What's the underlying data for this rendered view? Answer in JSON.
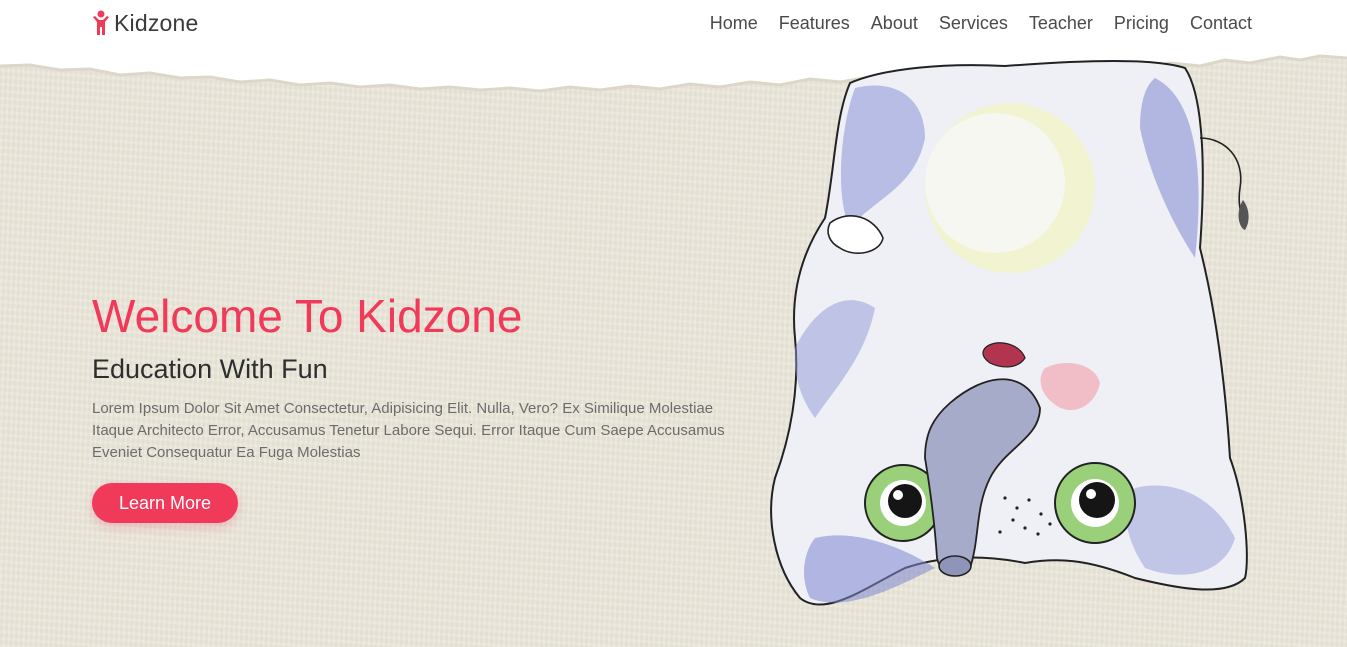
{
  "brand": {
    "name": "Kidzone",
    "icon": "child-icon",
    "accent": "#f13a5a"
  },
  "nav": {
    "items": [
      "Home",
      "Features",
      "About",
      "Services",
      "Teacher",
      "Pricing",
      "Contact"
    ]
  },
  "hero": {
    "title": "Welcome To Kidzone",
    "subtitle": "Education With Fun",
    "description": "Lorem Ipsum Dolor Sit Amet Consectetur, Adipisicing Elit. Nulla, Vero? Ex Similique Molestiae Itaque Architecto Error, Accusamus Tenetur Labore Sequi. Error Itaque Cum Saepe Accusamus Eveniet Consequatur Ea Fuga Molestias",
    "button_label": "Learn More",
    "illustration": "upside-down-cat-illustration"
  }
}
